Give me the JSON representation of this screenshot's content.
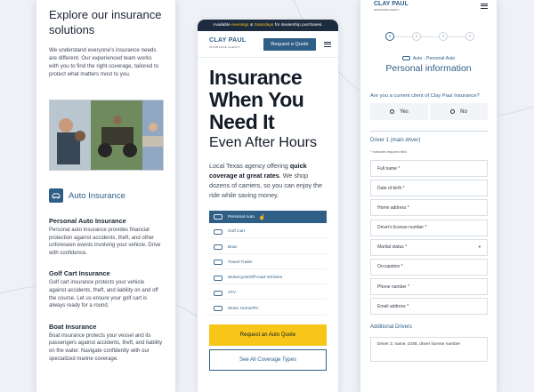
{
  "colors": {
    "brand_blue": "#2f5e86",
    "navy": "#1d2b3e",
    "accent_yellow": "#f7c619",
    "page_bg": "#eef1f5"
  },
  "panel1": {
    "heading": "Explore our insurance solutions",
    "lead": "We understand everyone's insurance needs are different. Our experienced team works with you to find the right coverage, tailored to protect what matters most to you.",
    "category_icon": "car-icon",
    "category_label": "Auto Insurance",
    "sections": [
      {
        "title": "Personal Auto Insurance",
        "body": "Personal auto insurance provides financial protection against accidents, theft, and other unforeseen events involving your vehicle. Drive with confidence."
      },
      {
        "title": "Golf Cart Insurance",
        "body": "Golf cart insurance protects your vehicle against accidents, theft, and liability on and off the course. Let us ensure your golf cart is always ready for a round."
      },
      {
        "title": "Boat Insurance",
        "body": "Boat insurance protects your vessel and its passengers against accidents, theft, and liability on the water. Navigate confidently with our specialized marine coverage."
      }
    ]
  },
  "panel2": {
    "topbar": {
      "pre": "Available",
      "evenings": "evenings",
      "amp": "&",
      "saturdays": "Saturdays",
      "post": "for dealership purchases."
    },
    "logo": {
      "name": "CLAY PAUL",
      "tagline": "INSURANCE AGENCY"
    },
    "quote_button": "Request a Quote",
    "menu_icon": "hamburger-menu-icon",
    "hero_title": "Insurance When You Need It",
    "hero_subtitle": "Even After Hours",
    "desc_pre": "Local Texas agency offering",
    "desc_bold": "quick coverage at great rates",
    "desc_post": ". We shop dozens of carriers, so you can enjoy the ride while saving money.",
    "coverage_items": [
      {
        "label": "Personal Auto",
        "icon": "car-icon",
        "active": true
      },
      {
        "label": "Golf Cart",
        "icon": "golf-cart-icon",
        "active": false
      },
      {
        "label": "Boat",
        "icon": "boat-icon",
        "active": false
      },
      {
        "label": "Travel Trailer",
        "icon": "trailer-icon",
        "active": false
      },
      {
        "label": "Motorcycle/Off-road Vehicles",
        "icon": "motorcycle-icon",
        "active": false
      },
      {
        "label": "ATV",
        "icon": "atv-icon",
        "active": false
      },
      {
        "label": "Motor Home/RV",
        "icon": "rv-icon",
        "active": false
      }
    ],
    "cta_primary": "Request an Auto Quote",
    "cta_secondary": "See All Coverage Types"
  },
  "panel3": {
    "logo": {
      "name": "CLAY PAUL",
      "tagline": "INSURANCE AGENCY"
    },
    "steps": [
      "1",
      "2",
      "3",
      "4"
    ],
    "current_step": 1,
    "crumb": "Auto - Personal Auto",
    "title": "Personal information",
    "question": "Are you a current client of Clay Paul Insurance?",
    "yes": "Yes",
    "no": "No",
    "driver_heading": "Driver 1 (main driver)",
    "required_note": "* Indicates required field",
    "fields": [
      "Full name *",
      "Date of birth *",
      "Home address *",
      "Driver's license number *",
      "Marital status *",
      "Occupation *",
      "Phone number *",
      "Email address *"
    ],
    "additional_heading": "Additional Drivers",
    "textarea_placeholder": "Driver 2: name, DOB, driver license number"
  }
}
